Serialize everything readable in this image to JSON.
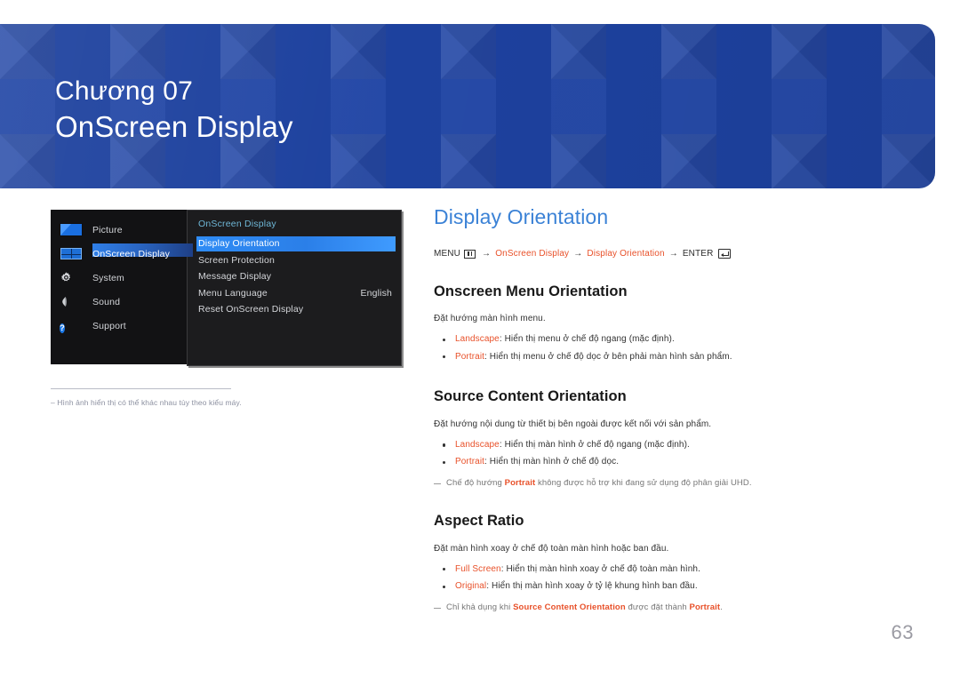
{
  "banner": {
    "kicker": "Chương 07",
    "title": "OnScreen Display",
    "bg_color": "#1e43a4"
  },
  "osd_screenshot": {
    "sidebar": {
      "items": [
        {
          "label": "Picture",
          "icon": "picture-icon",
          "selected": false
        },
        {
          "label": "OnScreen Display",
          "icon": "onscreen-display-icon",
          "selected": true
        },
        {
          "label": "System",
          "icon": "gear-icon",
          "selected": false
        },
        {
          "label": "Sound",
          "icon": "speaker-icon",
          "selected": false
        },
        {
          "label": "Support",
          "icon": "question-mark-icon",
          "selected": false
        }
      ]
    },
    "panel": {
      "title": "OnScreen Display",
      "items": [
        {
          "label": "Display Orientation",
          "value": "",
          "selected": true
        },
        {
          "label": "Screen Protection",
          "value": "",
          "selected": false
        },
        {
          "label": "Message Display",
          "value": "",
          "selected": false
        },
        {
          "label": "Menu Language",
          "value": "English",
          "selected": false
        },
        {
          "label": "Reset OnScreen Display",
          "value": "",
          "selected": false
        }
      ]
    },
    "caption": "Hình ảnh hiển thị có thể khác nhau tùy theo kiểu máy."
  },
  "content": {
    "heading": "Display Orientation",
    "breadcrumb": {
      "menu_label": "MENU",
      "menu_icon": "menu-icon",
      "arrow": "→",
      "step1": "OnScreen Display",
      "step2": "Display Orientation",
      "enter_label": "ENTER",
      "enter_icon": "enter-icon"
    },
    "sections": [
      {
        "heading": "Onscreen Menu Orientation",
        "intro": "Đặt hướng màn hình menu.",
        "bullets": [
          {
            "term": "Landscape",
            "text": ": Hiển thị menu ở chế độ ngang (mặc định)."
          },
          {
            "term": "Portrait",
            "text": ": Hiển thị menu ở chế độ dọc ở bên phải màn hình sản phẩm."
          }
        ],
        "note": null
      },
      {
        "heading": "Source Content Orientation",
        "intro": "Đặt hướng nội dung từ thiết bị bên ngoài được kết nối với sản phẩm.",
        "bullets": [
          {
            "term": "Landscape",
            "text": ": Hiển thị màn hình ở chế độ ngang (mặc định)."
          },
          {
            "term": "Portrait",
            "text": ": Hiển thị màn hình ở chế độ dọc."
          }
        ],
        "note": {
          "pre": "Chế độ hướng ",
          "hi1": "Portrait",
          "mid": " không được hỗ trợ khi đang sử dụng độ phân giải UHD.",
          "hi2": "",
          "post": ""
        }
      },
      {
        "heading": "Aspect Ratio",
        "intro": "Đặt màn hình xoay ở chế độ toàn màn hình hoặc ban đầu.",
        "bullets": [
          {
            "term": "Full Screen",
            "text": ": Hiển thị màn hình xoay ở chế độ toàn màn hình."
          },
          {
            "term": "Original",
            "text": ": Hiển thị màn hình xoay ở tỷ lệ khung hình ban đầu."
          }
        ],
        "note": {
          "pre": "Chỉ khả dụng khi ",
          "hi1": "Source Content Orientation",
          "mid": " được đặt thành ",
          "hi2": "Portrait",
          "post": "."
        }
      }
    ]
  },
  "page_number": "63"
}
